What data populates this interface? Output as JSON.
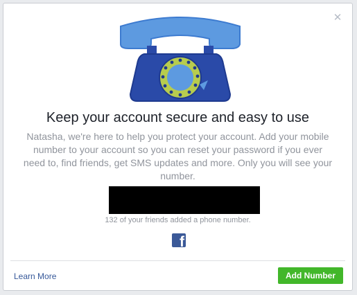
{
  "dialog": {
    "close_icon": "close-icon",
    "illustration": "telephone-illustration",
    "headline": "Keep your account secure and easy to use",
    "body": "Natasha, we're here to help you protect your account. Add your mobile number to your account so you can reset your password if you ever need to, find friends, get SMS updates and more. Only you will see your number.",
    "friends_note": "132 of your friends added a phone number.",
    "brand_icon": "facebook-icon",
    "brand_glyph": "f"
  },
  "footer": {
    "learn_more": "Learn More",
    "add_number": "Add Number"
  },
  "colors": {
    "primary_button": "#42b72a",
    "link": "#365899",
    "brand": "#3b5998",
    "phone_body": "#2a4aa8",
    "handset": "#5d9ae0",
    "dial_ring": "#b7cc4e"
  }
}
